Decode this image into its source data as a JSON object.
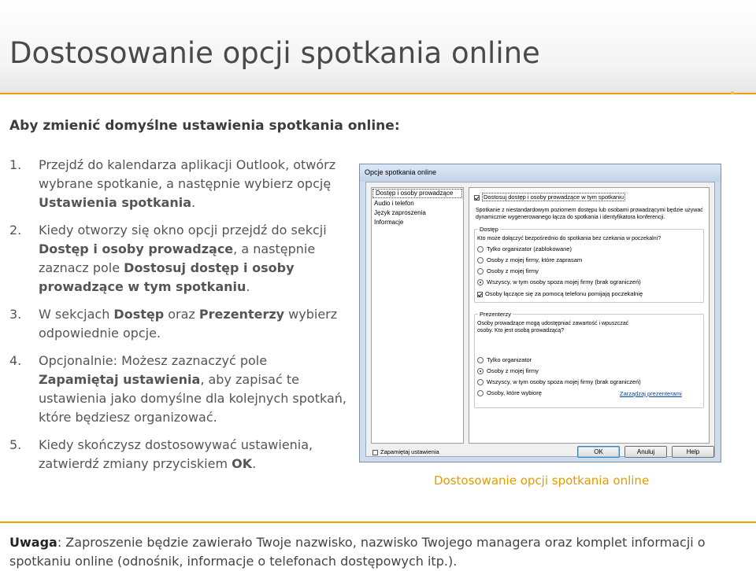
{
  "title": "Dostosowanie opcji spotkania online",
  "subheading": "Aby zmienić domyślne ustawienia spotkania online:",
  "steps": [
    {
      "num": "1.",
      "t1": "Przejdź do kalendarza aplikacji Outlook, otwórz wybrane spotkanie, a następnie wybierz opcję ",
      "b1": "Ustawienia spotkania",
      "t2": "."
    },
    {
      "num": "2.",
      "t1": "Kiedy otworzy się okno opcji przejdź do sekcji ",
      "b1": "Dostęp i osoby prowadzące",
      "t2": ", a następnie zaznacz pole ",
      "b2": "Dostosuj dostęp i osoby prowadzące w tym spotkaniu",
      "t3": "."
    },
    {
      "num": "3.",
      "t1": "W sekcjach ",
      "b1": "Dostęp",
      "t2": " oraz ",
      "b2": "Prezenterzy",
      "t3": " wybierz odpowiednie opcje."
    },
    {
      "num": "4.",
      "t1": "Opcjonalnie: Możesz zaznaczyć pole ",
      "b1": "Zapamiętaj ustawienia",
      "t2": ", aby zapisać te ustawienia jako domyślne dla kolejnych spotkań, które będziesz organizować."
    },
    {
      "num": "5.",
      "t1": "Kiedy skończysz dostosowywać ustawienia, zatwierdź zmiany przyciskiem ",
      "b1": "OK",
      "t2": "."
    }
  ],
  "caption": "Dostosowanie opcji spotkania online",
  "note": {
    "label": "Uwaga",
    "text": ": Zaproszenie będzie zawierało Twoje nazwisko, nazwisko Twojego managera oraz komplet informacji o spotkaniu online (odnośnik, informacje o telefonach dostępowych itp.)."
  },
  "colors": {
    "accent": "#e5a400",
    "caption": "#e59a00"
  },
  "dialog": {
    "title": "Opcje spotkania online",
    "nav": [
      "Dostęp i osoby prowadzące",
      "Audio i telefon",
      "Język zaproszenia",
      "Informacje"
    ],
    "customize_label": "Dostosuj dostęp i osoby prowadzące w tym spotkaniu",
    "customize_desc": "Spotkanie z niestandardowym poziomem dostępu lub osobami prowadzącymi będzie używać dynamicznie wygenerowanego łącza do spotkania i identyfikatora konferencji.",
    "access": {
      "label": "Dostęp",
      "question": "Kto może dołączyć bezpośrednio do spotkania bez czekania w poczekalni?",
      "options": [
        "Tylko organizator (zablokowane)",
        "Osoby z mojej firmy, które zaprasam",
        "Osoby z mojej firmy",
        "Wszyscy, w tym osoby spoza mojej firmy (brak ograniczeń)"
      ],
      "selected": 3,
      "phone_label": "Osoby łączące się za pomocą telefonu pomijają poczekalnię"
    },
    "presenters": {
      "label": "Prezenterzy",
      "question": "Osoby prowadzące mogą udostępniać zawartość i wpuszczać osoby. Kto jest osobą prowadzącą?",
      "options": [
        "Tylko organizator",
        "Osoby z mojej firmy",
        "Wszyscy, w tym osoby spoza mojej firmy (brak ograniczeń)",
        "Osoby, które wybiorę"
      ],
      "selected": 1,
      "manage_link": "Zarządzaj prezenterami"
    },
    "remember_label": "Zapamiętaj ustawienia",
    "buttons": {
      "ok": "OK",
      "cancel": "Anuluj",
      "help": "Help"
    }
  }
}
